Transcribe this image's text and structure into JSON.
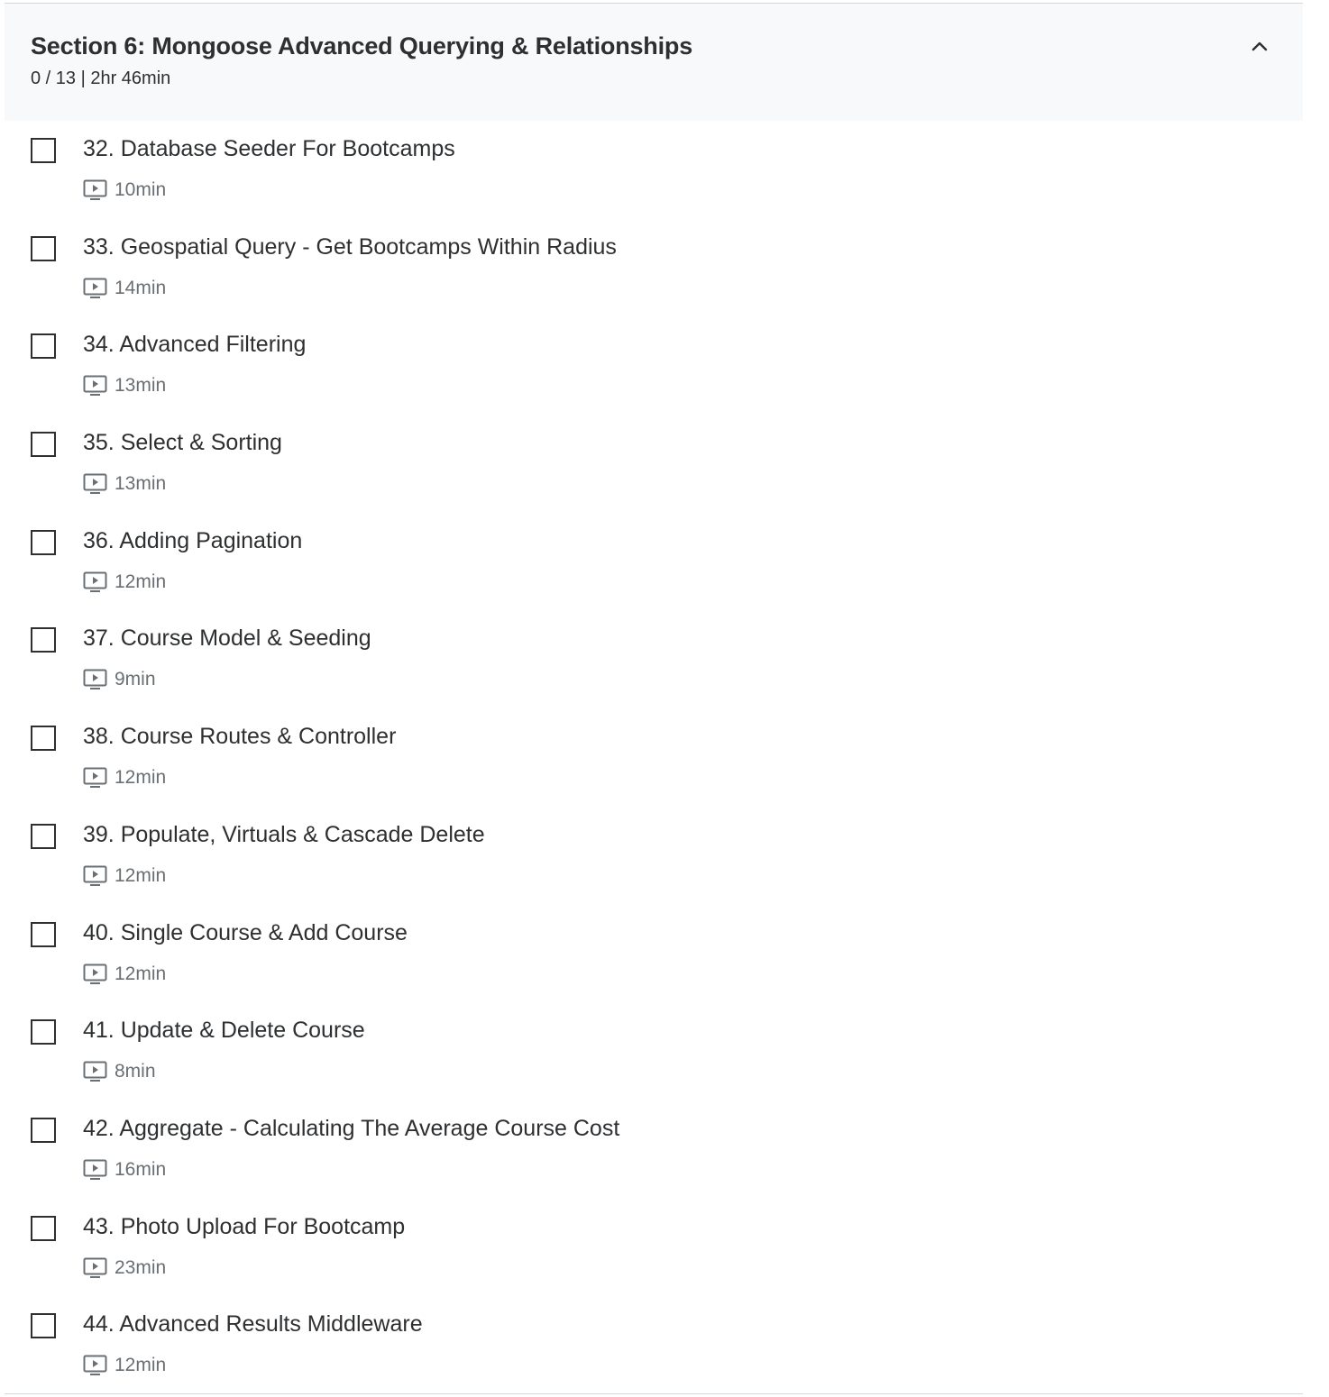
{
  "section": {
    "title": "Section 6: Mongoose Advanced Querying & Relationships",
    "meta": "0 / 13 | 2hr 46min",
    "collapse_icon": "chevron-up-icon"
  },
  "lectures": [
    {
      "title": "32. Database Seeder For Bootcamps",
      "duration": "10min",
      "icon": "video-icon"
    },
    {
      "title": "33. Geospatial Query - Get Bootcamps Within Radius",
      "duration": "14min",
      "icon": "video-icon"
    },
    {
      "title": "34. Advanced Filtering",
      "duration": "13min",
      "icon": "video-icon"
    },
    {
      "title": "35. Select & Sorting",
      "duration": "13min",
      "icon": "video-icon"
    },
    {
      "title": "36. Adding Pagination",
      "duration": "12min",
      "icon": "video-icon"
    },
    {
      "title": "37. Course Model & Seeding",
      "duration": "9min",
      "icon": "video-icon"
    },
    {
      "title": "38. Course Routes & Controller",
      "duration": "12min",
      "icon": "video-icon"
    },
    {
      "title": "39. Populate, Virtuals & Cascade Delete",
      "duration": "12min",
      "icon": "video-icon"
    },
    {
      "title": "40. Single Course & Add Course",
      "duration": "12min",
      "icon": "video-icon"
    },
    {
      "title": "41. Update & Delete Course",
      "duration": "8min",
      "icon": "video-icon"
    },
    {
      "title": "42. Aggregate - Calculating The Average Course Cost",
      "duration": "16min",
      "icon": "video-icon"
    },
    {
      "title": "43. Photo Upload For Bootcamp",
      "duration": "23min",
      "icon": "video-icon"
    },
    {
      "title": "44. Advanced Results Middleware",
      "duration": "12min",
      "icon": "video-icon"
    }
  ],
  "colors": {
    "header_bg": "#f7f9fa",
    "text": "#2d2f31",
    "muted_text": "#6a6f73",
    "border": "#d1d7dc"
  }
}
